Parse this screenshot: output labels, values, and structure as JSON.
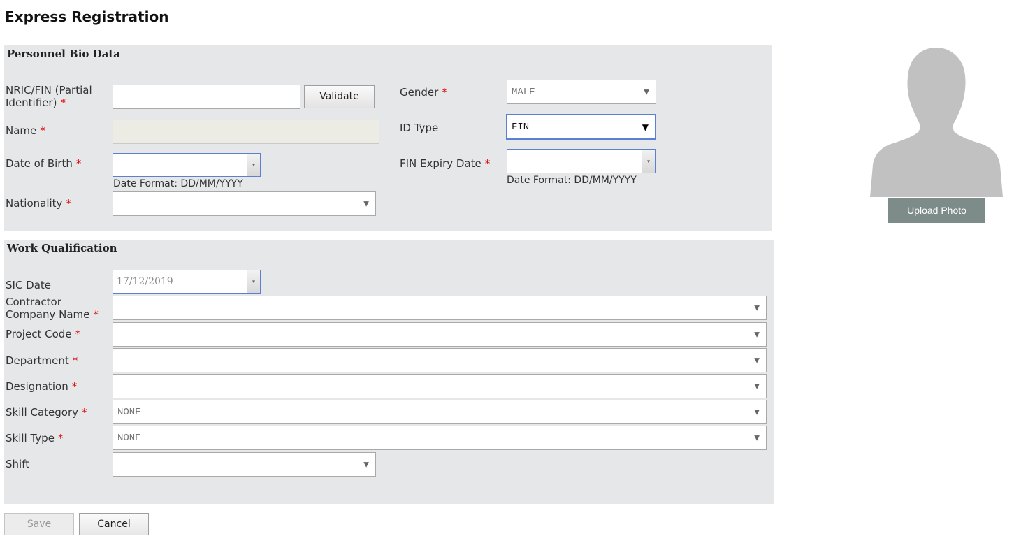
{
  "page": {
    "title": "Express Registration"
  },
  "bio": {
    "section_title": "Personnel Bio Data",
    "nric": {
      "label_line1": "NRIC/FIN (Partial",
      "label_line2": "Identifier)",
      "value": ""
    },
    "validate_label": "Validate",
    "name": {
      "label": "Name",
      "value": ""
    },
    "dob": {
      "label": "Date of Birth",
      "value": "",
      "hint": "Date Format: DD/MM/YYYY"
    },
    "nationality": {
      "label": "Nationality",
      "value": ""
    },
    "gender": {
      "label": "Gender",
      "value": "MALE"
    },
    "id_type": {
      "label": "ID Type",
      "value": "FIN"
    },
    "fin_expiry": {
      "label": "FIN Expiry Date",
      "value": "",
      "hint": "Date Format: DD/MM/YYYY"
    }
  },
  "work": {
    "section_title": "Work Qualification",
    "sic_date": {
      "label": "SIC Date",
      "value": "17/12/2019"
    },
    "contractor": {
      "label_line1": "Contractor",
      "label_line2": "Company Name",
      "value": ""
    },
    "project_code": {
      "label": "Project Code",
      "value": ""
    },
    "department": {
      "label": "Department",
      "value": ""
    },
    "designation": {
      "label": "Designation",
      "value": ""
    },
    "skill_category": {
      "label": "Skill Category",
      "value": "NONE"
    },
    "skill_type": {
      "label": "Skill Type",
      "value": "NONE"
    },
    "shift": {
      "label": "Shift",
      "value": ""
    }
  },
  "required_marker": "*",
  "caret_glyph": "▼",
  "date_glyph": "▾",
  "photo": {
    "upload_label": "Upload Photo",
    "icon": "person-silhouette-icon"
  },
  "actions": {
    "save_label": "Save",
    "cancel_label": "Cancel"
  },
  "colors": {
    "panel_bg": "#e6e7e8",
    "required": "#e00000",
    "upload_bg": "#7d8c89",
    "focus_border": "#5b7fd1"
  }
}
